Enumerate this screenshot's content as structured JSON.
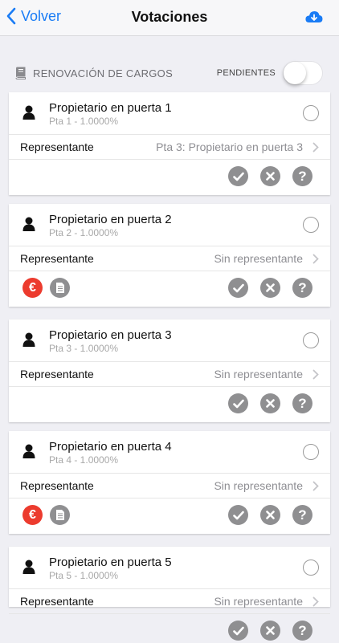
{
  "nav": {
    "back_label": "Volver",
    "title": "Votaciones"
  },
  "section": {
    "label": "RENOVACIÓN DE CARGOS",
    "pending_label": "PENDIENTES",
    "pending_toggle_on": false
  },
  "rep_label": "Representante",
  "icons": {
    "back": "chevron-left-icon",
    "cloud": "cloud-download-icon",
    "section": "book-icon",
    "person": "person-icon",
    "check": "check-icon",
    "cross": "cross-icon",
    "question": "question-icon",
    "euro": "euro-icon",
    "document": "document-icon"
  },
  "colors": {
    "accent": "#1a7cf5",
    "euro_badge": "#ec3b2e",
    "action_gray": "#8f8f91"
  },
  "action_question_glyph": "?",
  "euro_glyph": "€",
  "cards": [
    {
      "name": "Propietario en puerta 1",
      "sub": "Pta 1 - 1.0000%",
      "rep": "Pta 3: Propietario en puerta 3",
      "extras": false
    },
    {
      "name": "Propietario en puerta 2",
      "sub": "Pta 2 - 1.0000%",
      "rep": "Sin representante",
      "extras": true
    },
    {
      "name": "Propietario en puerta 3",
      "sub": "Pta 3 - 1.0000%",
      "rep": "Sin representante",
      "extras": false
    },
    {
      "name": "Propietario en puerta 4",
      "sub": "Pta 4 - 1.0000%",
      "rep": "Sin representante",
      "extras": true
    },
    {
      "name": "Propietario en puerta 5",
      "sub": "Pta 5 - 1.0000%",
      "rep": "Sin representante",
      "extras": false
    }
  ]
}
